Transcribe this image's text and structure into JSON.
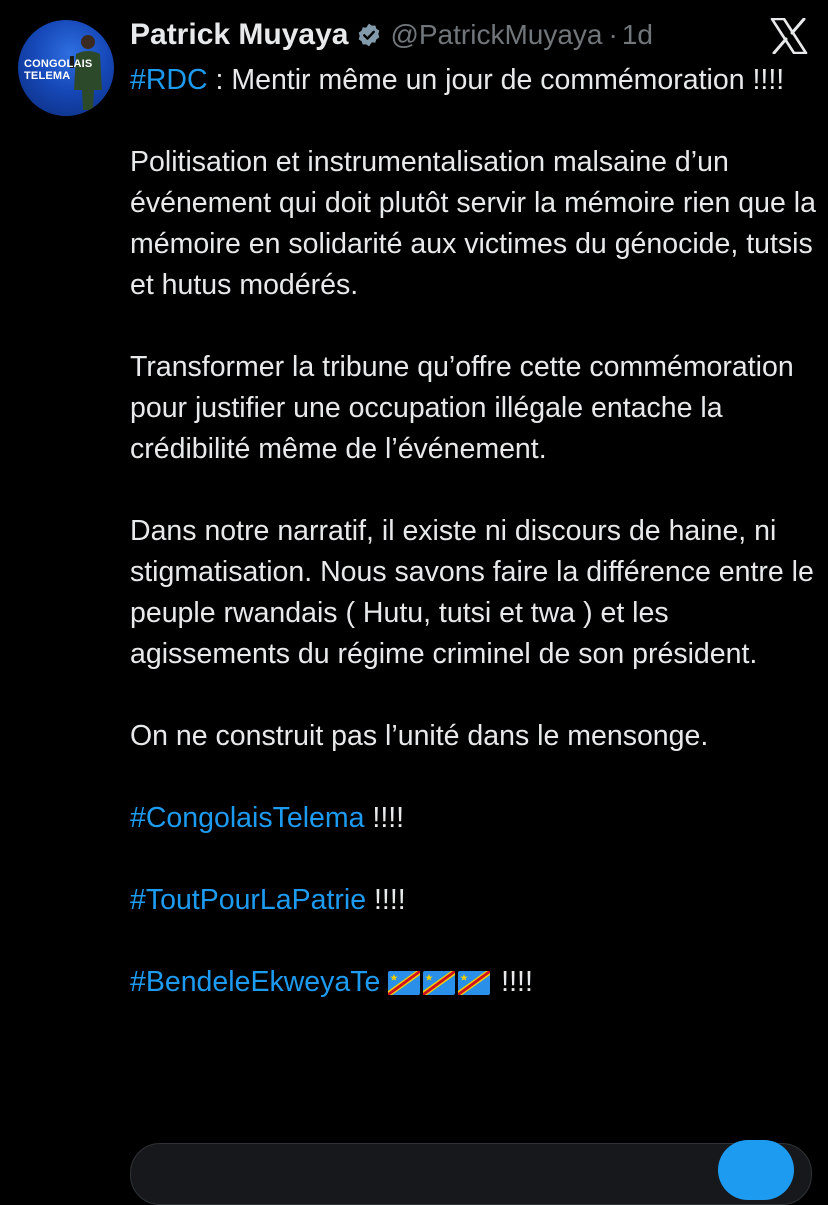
{
  "author": {
    "name": "Patrick Muyaya",
    "handle": "@PatrickMuyaya",
    "separator": "·",
    "time": "1d",
    "verified_icon": "verified-badge-icon",
    "avatar_text_top": "CONGOLAIS",
    "avatar_text_bottom": "TELEMA"
  },
  "header": {
    "close_icon": "x-logo-icon"
  },
  "tweet": {
    "line1_hashtag": "#RDC",
    "line1_text": " : Mentir même un jour de commémoration !!!!",
    "para1": "Politisation et instrumentalisation malsaine d’un événement qui doit plutôt servir la mémoire rien que la mémoire en solidarité aux victimes du génocide, tutsis et hutus modérés.",
    "para2": "Transformer la tribune qu’offre cette commémoration pour justifier une occupation illégale entache la crédibilité même de l’événement.",
    "para3": "Dans notre narratif, il existe ni discours de haine, ni stigmatisation. Nous savons faire la différence entre le peuple rwandais ( Hutu, tutsi et twa ) et les agissements du régime criminel de son président.",
    "para4": "On ne construit pas l’unité dans le mensonge.",
    "hashtag1": "#CongolaisTelema",
    "hashtag1_suffix": " !!!!",
    "hashtag2": "#ToutPourLaPatrie",
    "hashtag2_suffix": " !!!!",
    "hashtag3": "#BendeleEkweyaTe",
    "hashtag3_suffix": " !!!!",
    "flag_icon": "drc-flag-icon"
  },
  "colors": {
    "background": "#000000",
    "text": "#e7e9ea",
    "muted": "#71767b",
    "link": "#1d9bf0",
    "verified": "#829aab"
  }
}
